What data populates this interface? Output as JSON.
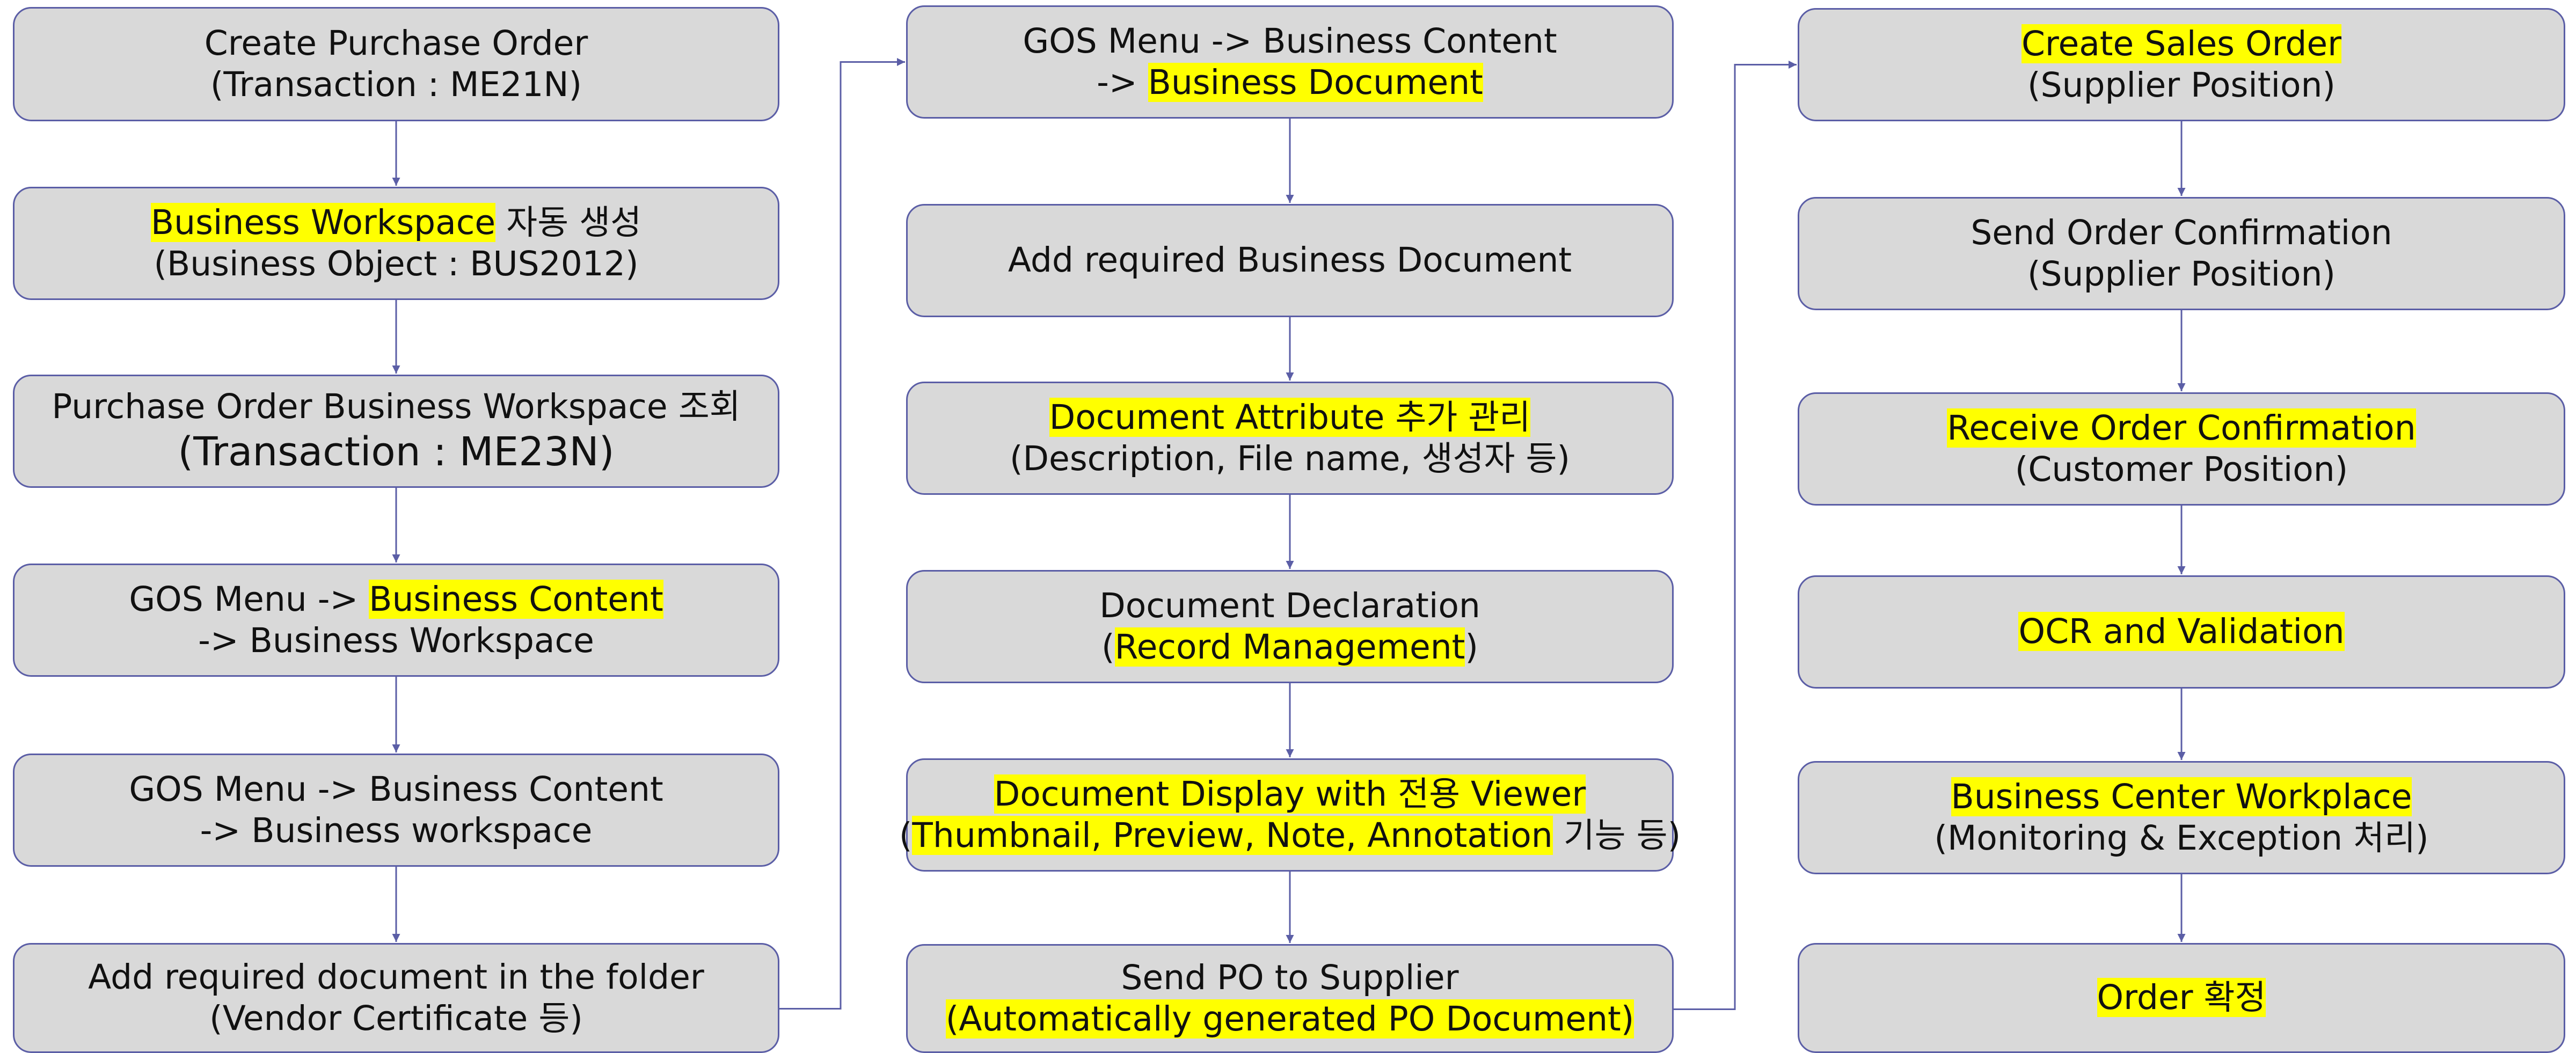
{
  "colors": {
    "highlight": "#ffff00",
    "box_fill": "#d9d9d9",
    "box_border": "#5b5ea6",
    "connector": "#5b5ea6"
  },
  "columns": [
    {
      "nodes": [
        {
          "lines": [
            {
              "parts": [
                {
                  "text": "Create Purchase Order",
                  "hl": false
                }
              ]
            },
            {
              "parts": [
                {
                  "text": "(Transaction : ME21N)",
                  "hl": false
                }
              ]
            }
          ]
        },
        {
          "lines": [
            {
              "parts": [
                {
                  "text": "Business Workspace",
                  "hl": true
                },
                {
                  "text": " 자동 생성",
                  "hl": false
                }
              ]
            },
            {
              "parts": [
                {
                  "text": "(Business Object : BUS2012)",
                  "hl": false
                }
              ]
            }
          ]
        },
        {
          "lines": [
            {
              "parts": [
                {
                  "text": "Purchase Order Business Workspace 조회",
                  "hl": false
                }
              ]
            },
            {
              "big": true,
              "parts": [
                {
                  "text": "(Transaction : ME23N)",
                  "hl": false
                }
              ]
            }
          ]
        },
        {
          "lines": [
            {
              "parts": [
                {
                  "text": "GOS Menu -> ",
                  "hl": false
                },
                {
                  "text": "Business Content",
                  "hl": true
                }
              ]
            },
            {
              "parts": [
                {
                  "text": "-> Business Workspace",
                  "hl": false
                }
              ]
            }
          ]
        },
        {
          "lines": [
            {
              "parts": [
                {
                  "text": "GOS Menu -> Business Content",
                  "hl": false
                }
              ]
            },
            {
              "parts": [
                {
                  "text": "-> Business workspace",
                  "hl": false
                }
              ]
            }
          ]
        },
        {
          "lines": [
            {
              "parts": [
                {
                  "text": "Add required document in the folder",
                  "hl": false
                }
              ]
            },
            {
              "parts": [
                {
                  "text": "(Vendor Certificate 등)",
                  "hl": false
                }
              ]
            }
          ]
        }
      ]
    },
    {
      "nodes": [
        {
          "lines": [
            {
              "parts": [
                {
                  "text": "GOS Menu -> Business Content",
                  "hl": false
                }
              ]
            },
            {
              "parts": [
                {
                  "text": "-> ",
                  "hl": false
                },
                {
                  "text": "Business Document",
                  "hl": true
                }
              ]
            }
          ]
        },
        {
          "lines": [
            {
              "parts": [
                {
                  "text": "Add required Business Document",
                  "hl": false
                }
              ]
            }
          ]
        },
        {
          "lines": [
            {
              "parts": [
                {
                  "text": "Document Attribute 추가 관리",
                  "hl": true
                }
              ]
            },
            {
              "parts": [
                {
                  "text": "(Description, File name, 생성자 등)",
                  "hl": false
                }
              ]
            }
          ]
        },
        {
          "lines": [
            {
              "parts": [
                {
                  "text": "Document Declaration",
                  "hl": false
                }
              ]
            },
            {
              "parts": [
                {
                  "text": "(",
                  "hl": false
                },
                {
                  "text": "Record Management",
                  "hl": true
                },
                {
                  "text": ")",
                  "hl": false
                }
              ]
            }
          ]
        },
        {
          "lines": [
            {
              "parts": [
                {
                  "text": "Document Display with 전용 Viewer",
                  "hl": true
                }
              ]
            },
            {
              "parts": [
                {
                  "text": "(",
                  "hl": false
                },
                {
                  "text": "Thumbnail, Preview, Note, Annotation",
                  "hl": true
                },
                {
                  "text": " 기능 등)",
                  "hl": false
                }
              ]
            }
          ]
        },
        {
          "lines": [
            {
              "parts": [
                {
                  "text": "Send PO to Supplier",
                  "hl": false
                }
              ]
            },
            {
              "parts": [
                {
                  "text": "(Automatically generated PO Document)",
                  "hl": true
                }
              ]
            }
          ]
        }
      ]
    },
    {
      "nodes": [
        {
          "lines": [
            {
              "parts": [
                {
                  "text": "Create Sales Order",
                  "hl": true
                }
              ]
            },
            {
              "parts": [
                {
                  "text": "(Supplier Position)",
                  "hl": false
                }
              ]
            }
          ]
        },
        {
          "lines": [
            {
              "parts": [
                {
                  "text": "Send Order Confirmation",
                  "hl": false
                }
              ]
            },
            {
              "parts": [
                {
                  "text": "(Supplier Position)",
                  "hl": false
                }
              ]
            }
          ]
        },
        {
          "lines": [
            {
              "parts": [
                {
                  "text": "Receive Order Confirmation",
                  "hl": true
                }
              ]
            },
            {
              "parts": [
                {
                  "text": "(Customer Position)",
                  "hl": false
                }
              ]
            }
          ]
        },
        {
          "lines": [
            {
              "parts": [
                {
                  "text": "OCR and Validation",
                  "hl": true
                }
              ]
            }
          ]
        },
        {
          "lines": [
            {
              "parts": [
                {
                  "text": "Business Center Workplace",
                  "hl": true
                }
              ]
            },
            {
              "parts": [
                {
                  "text": "(Monitoring & Exception 처리)",
                  "hl": false
                }
              ]
            }
          ]
        },
        {
          "lines": [
            {
              "parts": [
                {
                  "text": "Order 확정",
                  "hl": true
                }
              ]
            }
          ]
        }
      ]
    }
  ]
}
